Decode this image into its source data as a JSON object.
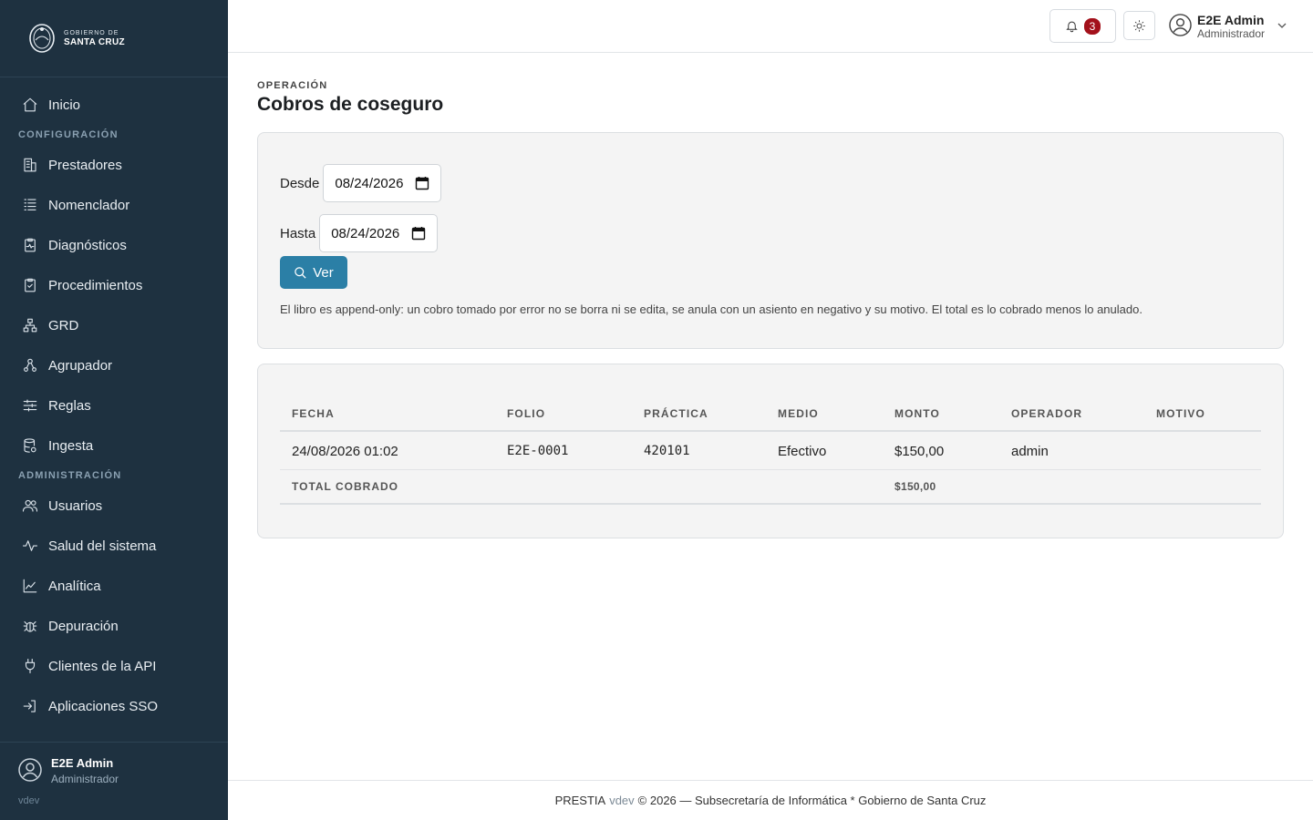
{
  "brand": {
    "line1": "GOBIERNO DE",
    "line2": "SANTA CRUZ"
  },
  "sidebar": {
    "items_top": [
      {
        "label": "Inicio",
        "icon": "home-icon"
      }
    ],
    "sections": [
      {
        "title": "CONFIGURACIÓN",
        "items": [
          {
            "label": "Prestadores",
            "icon": "building-icon"
          },
          {
            "label": "Nomenclador",
            "icon": "list-icon"
          },
          {
            "label": "Diagnósticos",
            "icon": "clipboard-pulse-icon"
          },
          {
            "label": "Procedimientos",
            "icon": "clipboard-check-icon"
          },
          {
            "label": "GRD",
            "icon": "hierarchy-icon"
          },
          {
            "label": "Agrupador",
            "icon": "group-icon"
          },
          {
            "label": "Reglas",
            "icon": "sliders-icon"
          },
          {
            "label": "Ingesta",
            "icon": "database-icon"
          }
        ]
      },
      {
        "title": "ADMINISTRACIÓN",
        "items": [
          {
            "label": "Usuarios",
            "icon": "users-icon"
          },
          {
            "label": "Salud del sistema",
            "icon": "activity-icon"
          },
          {
            "label": "Analítica",
            "icon": "chart-line-icon"
          },
          {
            "label": "Depuración",
            "icon": "bug-icon"
          },
          {
            "label": "Clientes de la API",
            "icon": "plug-icon"
          },
          {
            "label": "Aplicaciones SSO",
            "icon": "login-icon"
          }
        ]
      }
    ],
    "user": {
      "name": "E2E Admin",
      "role": "Administrador",
      "version": "vdev"
    }
  },
  "topbar": {
    "notifications_count": "3",
    "user": {
      "name": "E2E Admin",
      "role": "Administrador"
    }
  },
  "page": {
    "eyebrow": "OPERACIÓN",
    "title": "Cobros de coseguro"
  },
  "filters": {
    "desde_label": "Desde",
    "desde_value": "08/24/2026",
    "hasta_label": "Hasta",
    "hasta_value": "08/24/2026",
    "ver_label": "Ver",
    "hint": "El libro es append-only: un cobro tomado por error no se borra ni se edita, se anula con un asiento en negativo y su motivo. El total es lo cobrado menos lo anulado."
  },
  "table": {
    "headers": [
      "FECHA",
      "FOLIO",
      "PRÁCTICA",
      "MEDIO",
      "MONTO",
      "OPERADOR",
      "MOTIVO"
    ],
    "rows": [
      {
        "fecha": "24/08/2026 01:02",
        "folio": "E2E-0001",
        "practica": "420101",
        "medio": "Efectivo",
        "monto": "$150,00",
        "operador": "admin",
        "motivo": ""
      }
    ],
    "total_label": "TOTAL COBRADO",
    "total_value": "$150,00"
  },
  "footer": {
    "app": "PRESTIA",
    "version": "vdev",
    "text": "© 2026 — Subsecretaría de Informática * Gobierno de Santa Cruz"
  }
}
